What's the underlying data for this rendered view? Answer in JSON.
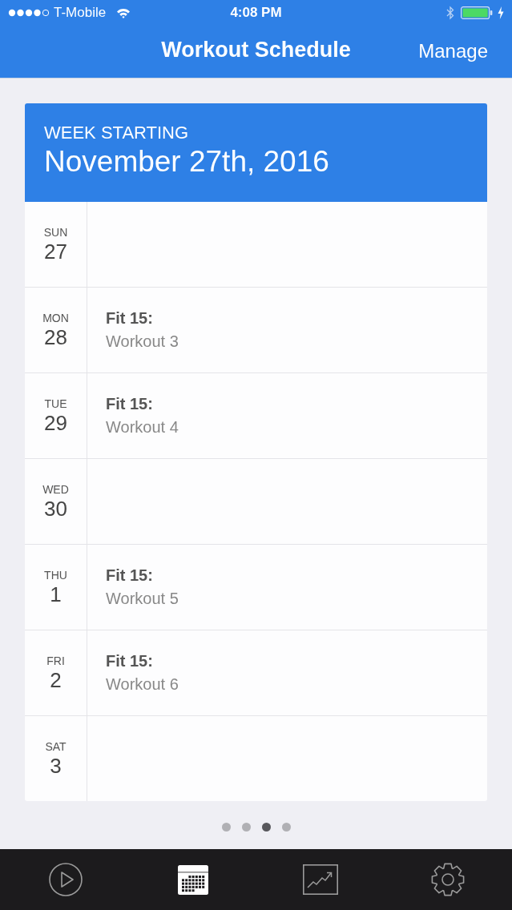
{
  "status_bar": {
    "carrier": "T-Mobile",
    "time": "4:08 PM"
  },
  "nav_bar": {
    "title": "Workout Schedule",
    "action": "Manage"
  },
  "week": {
    "label": "WEEK STARTING",
    "date": "November 27th, 2016"
  },
  "days": [
    {
      "weekday": "SUN",
      "day": "27"
    },
    {
      "weekday": "MON",
      "day": "28",
      "workout": {
        "program": "Fit 15:",
        "name": "Workout 3"
      }
    },
    {
      "weekday": "TUE",
      "day": "29",
      "workout": {
        "program": "Fit 15:",
        "name": "Workout 4"
      }
    },
    {
      "weekday": "WED",
      "day": "30"
    },
    {
      "weekday": "THU",
      "day": "1",
      "workout": {
        "program": "Fit 15:",
        "name": "Workout 5"
      }
    },
    {
      "weekday": "FRI",
      "day": "2",
      "workout": {
        "program": "Fit 15:",
        "name": "Workout 6"
      }
    },
    {
      "weekday": "SAT",
      "day": "3"
    }
  ],
  "page_dots": [
    {
      "selected": false
    },
    {
      "selected": false
    },
    {
      "selected": true
    },
    {
      "selected": false
    }
  ],
  "tab_bar": [
    {
      "kind": "play",
      "selected": false
    },
    {
      "kind": "calendar",
      "selected": true
    },
    {
      "kind": "chart",
      "selected": false
    },
    {
      "kind": "settings",
      "selected": false
    }
  ]
}
